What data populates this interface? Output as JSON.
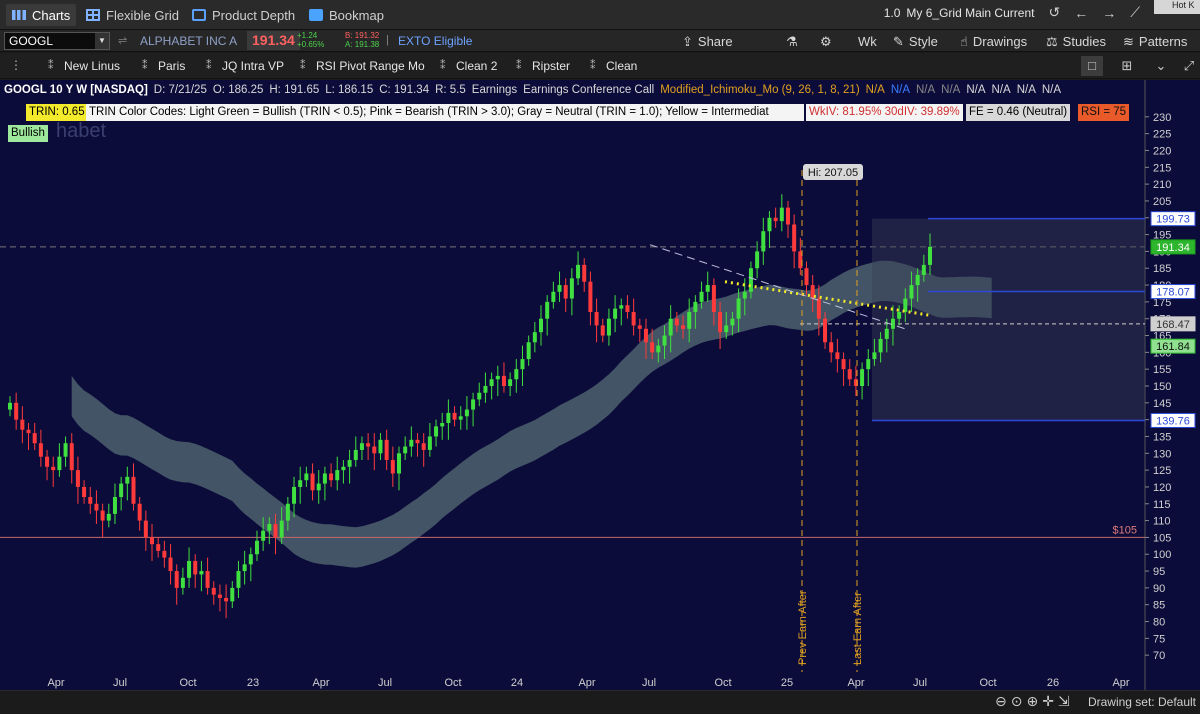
{
  "tabs": [
    {
      "label": "Charts",
      "icon": "charts-icon",
      "active": true
    },
    {
      "label": "Flexible Grid",
      "icon": "grid-icon"
    },
    {
      "label": "Product Depth",
      "icon": "depth-icon"
    },
    {
      "label": "Bookmap",
      "icon": "bookmap-icon"
    }
  ],
  "workspace": {
    "zoom": "1.0",
    "name": "My 6_Grid Main Current",
    "hotkey": "Hot K"
  },
  "symbol": {
    "ticker": "GOOGL",
    "company": "ALPHABET INC A",
    "last": "191.34",
    "change": "+1.24",
    "change_pct": "+0.65%",
    "bid": "B: 191.32",
    "ask": "A: 191.38",
    "exto": "EXTO Eligible"
  },
  "toolbar": {
    "share": "Share",
    "wk": "Wk",
    "style": "Style",
    "drawings": "Drawings",
    "studies": "Studies",
    "patterns": "Patterns"
  },
  "studies": [
    "New Linus",
    "Paris",
    "JQ Intra VP",
    "RSI Pivot Range Mo",
    "Clean 2",
    "Ripster",
    "Clean"
  ],
  "header": {
    "title": "GOOGL 10 Y W [NASDAQ]",
    "date": "D: 7/21/25",
    "open": "O: 186.25",
    "high": "H: 191.65",
    "low": "L: 186.15",
    "close": "C: 191.34",
    "range": "R: 5.5",
    "earnings": "Earnings",
    "ecc": "Earnings Conference Call",
    "ichimoku": "Modified_Ichimoku_Mo (9, 26, 1, 8, 21)",
    "na": [
      "N/A",
      "N/A",
      "N/A",
      "N/A",
      "N/A",
      "N/A",
      "N/A",
      "N/A"
    ]
  },
  "labels": {
    "trin": "TRIN: 0.65",
    "trin_codes": "TRIN Color Codes: Light Green = Bullish (TRIN < 0.5); Pink = Bearish (TRIN > 3.0); Gray = Neutral (TRIN = 1.0); Yellow = Intermediat",
    "wkiv": "WkIV: 81.95%  30dIV: 39.89%",
    "fe": "FE = 0.46 (Neutral)",
    "rsi": "RSI = 75",
    "bullish": "Bullish",
    "watermark": "habet",
    "hi": "Hi: 207.05",
    "level_105": "$105",
    "prev_earn": "Prev Earn After",
    "last_earn": "Last Earn After"
  },
  "price_tags": [
    {
      "value": "199.73",
      "color": "#2b49d8",
      "text_color": "#2b49d8",
      "bg": "#ffffff"
    },
    {
      "value": "191.34",
      "color": "#1aa01a",
      "text_color": "#ffffff",
      "bg": "#2db52d"
    },
    {
      "value": "178.07",
      "color": "#2b49d8",
      "text_color": "#2b49d8",
      "bg": "#ffffff"
    },
    {
      "value": "168.47",
      "color": "#cfcfcf",
      "text_color": "#333333",
      "bg": "#cfcfcf"
    },
    {
      "value": "161.84",
      "color": "#2db52d",
      "text_color": "#111111",
      "bg": "#8fe08f"
    },
    {
      "value": "139.76",
      "color": "#2b49d8",
      "text_color": "#2b49d8",
      "bg": "#ffffff"
    }
  ],
  "bottom": {
    "drawing_set": "Drawing set: Default"
  },
  "chart_data": {
    "type": "candlestick",
    "title": "GOOGL 10 Y W [NASDAQ]",
    "ylim": [
      65,
      235
    ],
    "y_ticks": [
      70,
      75,
      80,
      85,
      90,
      95,
      100,
      105,
      110,
      115,
      120,
      125,
      130,
      135,
      140,
      145,
      150,
      155,
      160,
      165,
      170,
      175,
      180,
      185,
      190,
      195,
      200,
      205,
      210,
      215,
      220,
      225,
      230
    ],
    "x_ticks": [
      "Apr",
      "Jul",
      "Oct",
      "23",
      "Apr",
      "Jul",
      "Oct",
      "24",
      "Apr",
      "Jul",
      "Oct",
      "25",
      "Apr",
      "Jul",
      "Oct",
      "26",
      "Apr"
    ],
    "horizontal_level": 105,
    "hi_annotation": 207.05,
    "closes": [
      145,
      140,
      137,
      136,
      133,
      129,
      126,
      125,
      129,
      133,
      125,
      120,
      117,
      115,
      113,
      110,
      112,
      117,
      121,
      123,
      115,
      110,
      105,
      103,
      101,
      99,
      95,
      90,
      93,
      98,
      94,
      95,
      90,
      88,
      87,
      86,
      90,
      95,
      97,
      100,
      104,
      107,
      109,
      105,
      110,
      115,
      120,
      122,
      124,
      119,
      121,
      124,
      122,
      125,
      126,
      128,
      131,
      133,
      132,
      130,
      134,
      128,
      124,
      130,
      132,
      134,
      133,
      131,
      135,
      138,
      139,
      142,
      140,
      141,
      143,
      146,
      148,
      150,
      152,
      153,
      150,
      152,
      155,
      158,
      163,
      166,
      170,
      175,
      178,
      180,
      176,
      182,
      186,
      181,
      172,
      168,
      165,
      170,
      173,
      174,
      172,
      168,
      167,
      163,
      160,
      162,
      165,
      170,
      168,
      167,
      172,
      175,
      178,
      180,
      172,
      166,
      168,
      170,
      176,
      178,
      185,
      190,
      196,
      200,
      199,
      203,
      198,
      190,
      185,
      180,
      176,
      170,
      163,
      160,
      158,
      155,
      152,
      150,
      155,
      158,
      160,
      164,
      167,
      170,
      172,
      176,
      180,
      183,
      186,
      191.34
    ],
    "cloud": {
      "note": "Ichimoku cloud shown shaded"
    }
  }
}
